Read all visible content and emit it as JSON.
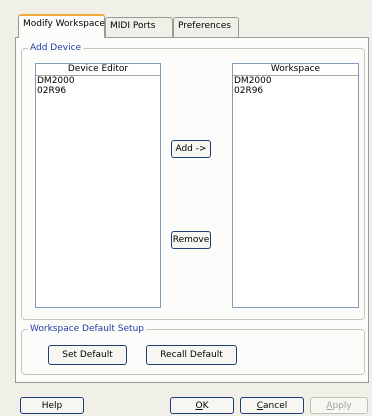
{
  "tabs": [
    {
      "label": "Modify Workspace",
      "active": true
    },
    {
      "label": "MIDI Ports",
      "active": false
    },
    {
      "label": "Preferences",
      "active": false
    }
  ],
  "add_device": {
    "title": "Add Device",
    "device_editor": {
      "header": "Device Editor",
      "items": [
        "DM2000",
        "02R96"
      ]
    },
    "workspace": {
      "header": "Workspace",
      "items": [
        "DM2000",
        "02R96"
      ]
    },
    "add_label": "Add ->",
    "remove_label": "Remove"
  },
  "default_setup": {
    "title": "Workspace Default Setup",
    "set_default_label": "Set Default",
    "recall_default_label": "Recall Default"
  },
  "footer": {
    "help_label": "Help",
    "ok_label": "OK",
    "cancel_label": "Cancel",
    "apply_label": "Apply"
  },
  "colors": {
    "window_bg": "#f0efe8",
    "panel_bg": "#fcfcfa",
    "active_tab_accent": "#f2a73c",
    "group_title": "#1c3fa8",
    "button_border": "#1f3c7a"
  }
}
